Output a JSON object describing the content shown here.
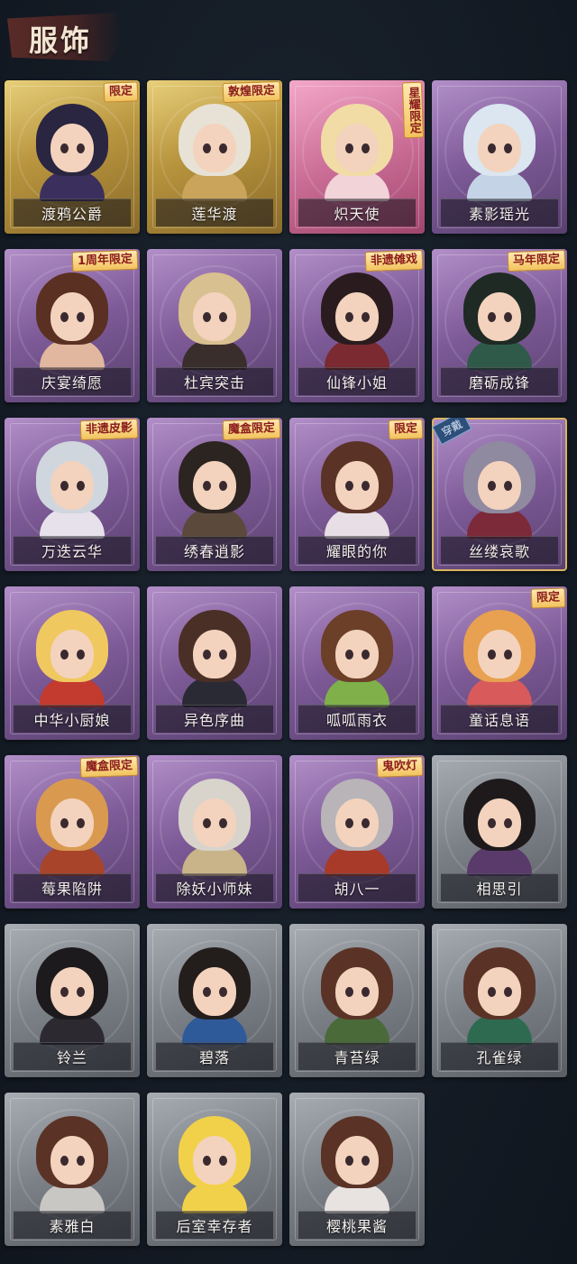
{
  "header": {
    "title": "服饰"
  },
  "items": [
    {
      "name": "渡鸦公爵",
      "badge": "限定",
      "badge_style": "h",
      "tier": "gold",
      "hair": "#2a2540",
      "body": "#3b2f5e",
      "equipped": false
    },
    {
      "name": "莲华渡",
      "badge": "敦煌限定",
      "badge_style": "h",
      "tier": "gold",
      "hair": "#e8e2d6",
      "body": "#c9a45a",
      "equipped": false
    },
    {
      "name": "炽天使",
      "badge": "星耀限定",
      "badge_style": "v",
      "tier": "pink",
      "hair": "#f1dca6",
      "body": "#f2d3d8",
      "equipped": false
    },
    {
      "name": "素影瑶光",
      "badge": "",
      "badge_style": "h",
      "tier": "purple",
      "hair": "#dbe6f0",
      "body": "#c4d4e6",
      "equipped": false
    },
    {
      "name": "庆宴绮愿",
      "badge": "1周年限定",
      "badge_style": "h",
      "tier": "purple",
      "hair": "#5a3022",
      "body": "#e2b7a0",
      "equipped": false
    },
    {
      "name": "杜宾突击",
      "badge": "",
      "badge_style": "h",
      "tier": "purple",
      "hair": "#d9c090",
      "body": "#3a2e2c",
      "equipped": false
    },
    {
      "name": "仙锋小姐",
      "badge": "非遗傩戏",
      "badge_style": "h",
      "tier": "purple",
      "hair": "#2a1c1e",
      "body": "#7a2a30",
      "equipped": false
    },
    {
      "name": "磨砺成锋",
      "badge": "马年限定",
      "badge_style": "h",
      "tier": "purple",
      "hair": "#1f2a24",
      "body": "#2f5a4a",
      "equipped": false
    },
    {
      "name": "万迭云华",
      "badge": "非遗皮影",
      "badge_style": "h",
      "tier": "purple",
      "hair": "#cfd6de",
      "body": "#e7e1ec",
      "equipped": false
    },
    {
      "name": "绣春逍影",
      "badge": "魔盒限定",
      "badge_style": "h",
      "tier": "purple",
      "hair": "#2b2420",
      "body": "#5b4a3c",
      "equipped": false
    },
    {
      "name": "耀眼的你",
      "badge": "限定",
      "badge_style": "h",
      "tier": "purple",
      "hair": "#5a3326",
      "body": "#e8dfe6",
      "equipped": false
    },
    {
      "name": "丝缕哀歌",
      "badge": "",
      "badge_style": "h",
      "tier": "purple",
      "hair": "#8f8aa0",
      "body": "#7c2a3a",
      "equipped": true,
      "equipped_label": "穿戴"
    },
    {
      "name": "中华小厨娘",
      "badge": "",
      "badge_style": "h",
      "tier": "purple",
      "hair": "#f0c860",
      "body": "#c33a2e",
      "equipped": false
    },
    {
      "name": "异色序曲",
      "badge": "",
      "badge_style": "h",
      "tier": "purple",
      "hair": "#4a2f26",
      "body": "#2a2a34",
      "equipped": false
    },
    {
      "name": "呱呱雨衣",
      "badge": "",
      "badge_style": "h",
      "tier": "purple",
      "hair": "#6b3f28",
      "body": "#7fb04a",
      "equipped": false
    },
    {
      "name": "童话息语",
      "badge": "限定",
      "badge_style": "h",
      "tier": "purple",
      "hair": "#e7a150",
      "body": "#d85a5a",
      "equipped": false
    },
    {
      "name": "莓果陷阱",
      "badge": "魔盒限定",
      "badge_style": "h",
      "tier": "purple",
      "hair": "#d99a50",
      "body": "#a8442a",
      "equipped": false
    },
    {
      "name": "除妖小师妹",
      "badge": "",
      "badge_style": "h",
      "tier": "purple",
      "hair": "#d8d4cc",
      "body": "#c9b48a",
      "equipped": false
    },
    {
      "name": "胡八一",
      "badge": "鬼吹灯",
      "badge_style": "h",
      "tier": "purple",
      "hair": "#b8b4b8",
      "body": "#a83a2a",
      "equipped": false
    },
    {
      "name": "相思引",
      "badge": "",
      "badge_style": "h",
      "tier": "gray",
      "hair": "#1e1a1c",
      "body": "#5a3a6a",
      "equipped": false
    },
    {
      "name": "铃兰",
      "badge": "",
      "badge_style": "h",
      "tier": "gray",
      "hair": "#1c1a1c",
      "body": "#2c2a30",
      "equipped": false
    },
    {
      "name": "碧落",
      "badge": "",
      "badge_style": "h",
      "tier": "gray",
      "hair": "#231d1c",
      "body": "#2e5a9a",
      "equipped": false
    },
    {
      "name": "青苔绿",
      "badge": "",
      "badge_style": "h",
      "tier": "gray",
      "hair": "#5a3326",
      "body": "#4a6a3a",
      "equipped": false
    },
    {
      "name": "孔雀绿",
      "badge": "",
      "badge_style": "h",
      "tier": "gray",
      "hair": "#5a3326",
      "body": "#2e6a50",
      "equipped": false
    },
    {
      "name": "素雅白",
      "badge": "",
      "badge_style": "h",
      "tier": "gray",
      "hair": "#5a3326",
      "body": "#c9c7c4",
      "equipped": false
    },
    {
      "name": "后室幸存者",
      "badge": "",
      "badge_style": "h",
      "tier": "gray",
      "hair": "#f2d14a",
      "body": "#f2d14a",
      "equipped": false
    },
    {
      "name": "樱桃果酱",
      "badge": "",
      "badge_style": "h",
      "tier": "gray",
      "hair": "#5a3326",
      "body": "#e8e3e0",
      "equipped": false
    }
  ]
}
